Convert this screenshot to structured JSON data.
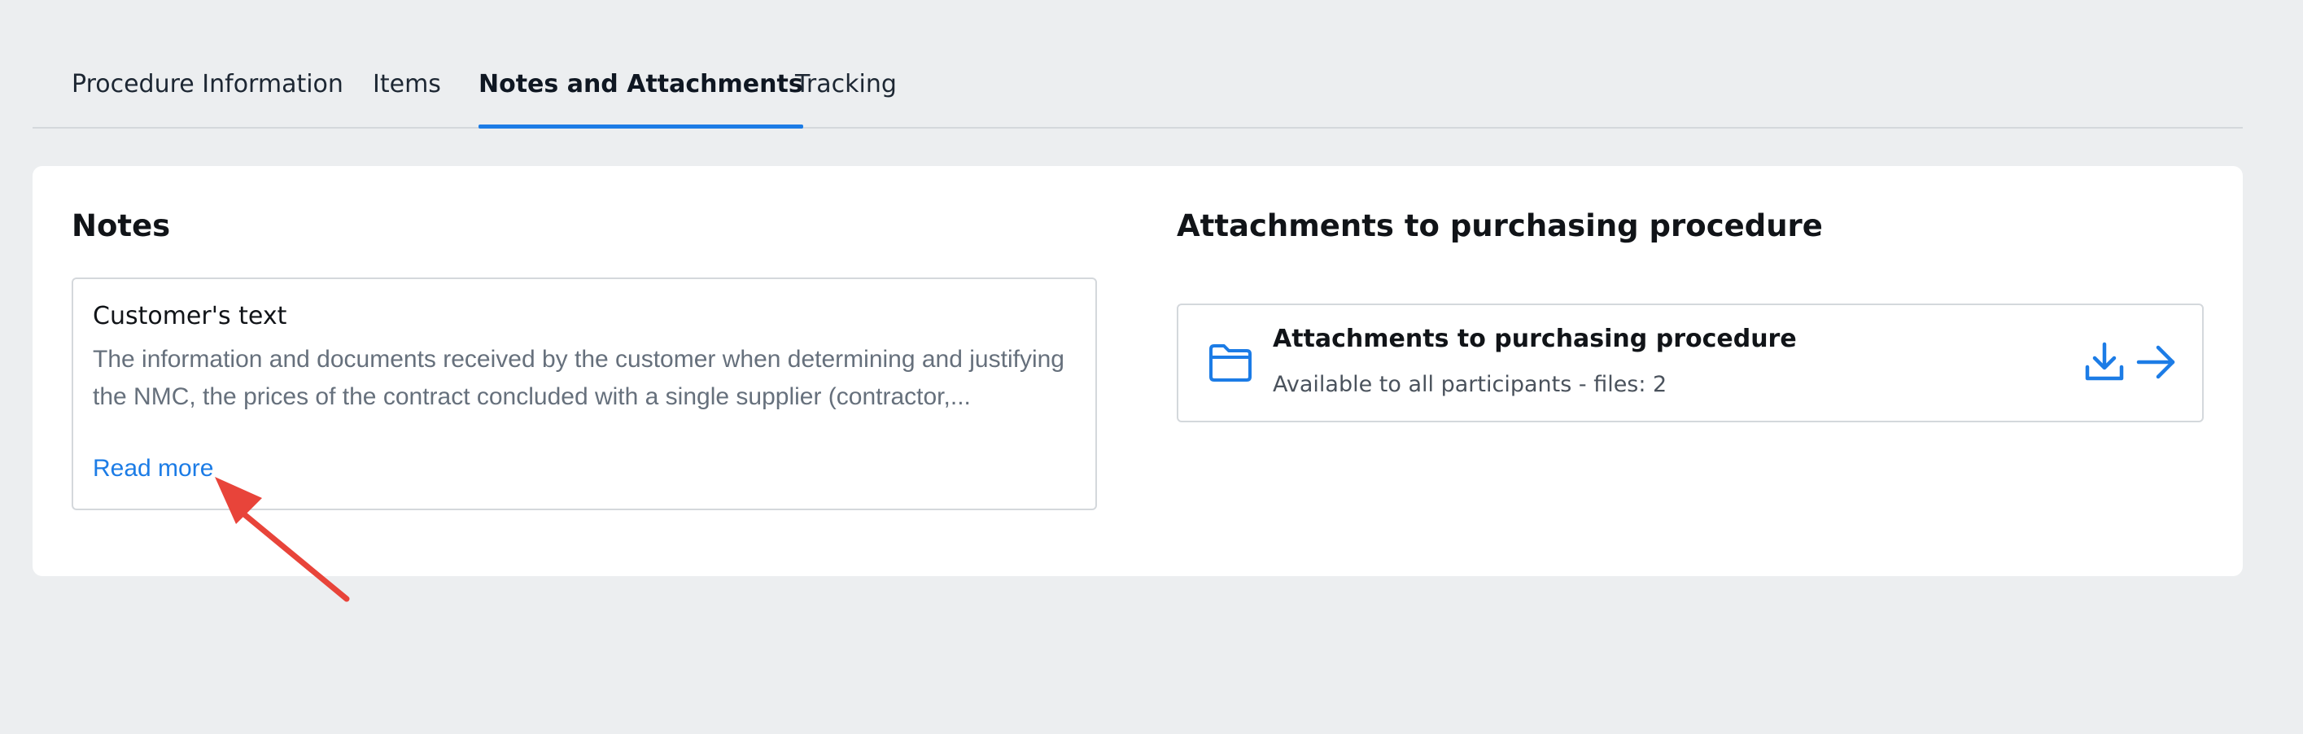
{
  "tabs": [
    {
      "label": "Procedure Information",
      "active": false
    },
    {
      "label": "Items",
      "active": false
    },
    {
      "label": "Notes and Attachments",
      "active": true
    },
    {
      "label": "Tracking",
      "active": false
    }
  ],
  "notes": {
    "title": "Notes",
    "card": {
      "title": "Customer's text",
      "text": "The information and documents received by the customer when determining and justifying the NMC, the prices of the contract concluded with a single supplier (contractor,...",
      "read_more": "Read more"
    }
  },
  "attachments": {
    "title": "Attachments to purchasing procedure",
    "item": {
      "title": "Attachments to purchasing procedure",
      "subtitle": "Available to all participants - files: 2",
      "icon": "folder-icon",
      "actions": [
        "download-icon",
        "arrow-right-icon"
      ]
    }
  },
  "colors": {
    "accent": "#1c7ce6",
    "annotation_arrow": "#e8443a",
    "background": "#eceef0",
    "panel": "#ffffff"
  }
}
